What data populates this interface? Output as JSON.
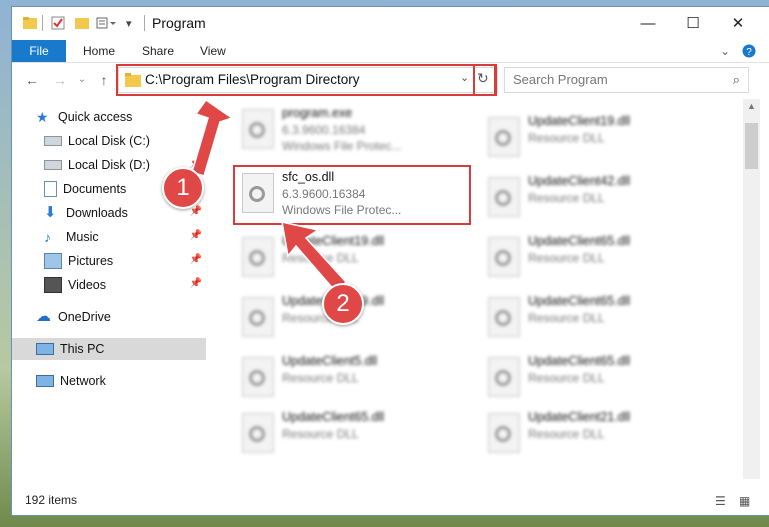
{
  "window": {
    "title": "Program",
    "minimize_glyph": "—",
    "maximize_glyph": "☐",
    "close_glyph": "✕"
  },
  "ribbon": {
    "tabs": [
      "File",
      "Home",
      "Share",
      "View"
    ]
  },
  "address": {
    "path": "C:\\Program Files\\Program Directory"
  },
  "search": {
    "placeholder": "Search Program"
  },
  "nav_pane": {
    "items": [
      {
        "label": "Quick access",
        "icon": "star-icon"
      },
      {
        "label": "Local Disk (C:)",
        "icon": "drive-icon"
      },
      {
        "label": "Local Disk (D:)",
        "icon": "drive-icon"
      },
      {
        "label": "Documents",
        "icon": "documents-icon"
      },
      {
        "label": "Downloads",
        "icon": "download-icon"
      },
      {
        "label": "Music",
        "icon": "music-icon"
      },
      {
        "label": "Pictures",
        "icon": "pictures-icon"
      },
      {
        "label": "Videos",
        "icon": "videos-icon"
      },
      {
        "label": "OneDrive",
        "icon": "cloud-icon"
      },
      {
        "label": "This PC",
        "icon": "computer-icon"
      },
      {
        "label": "Network",
        "icon": "network-icon"
      }
    ]
  },
  "files": [
    {
      "name": "program.exe",
      "line2": "6.3.9600.16384",
      "line3": "Windows File Protec..."
    },
    {
      "name": "sfc_os.dll",
      "line2": "6.3.9600.16384",
      "line3": "Windows File Protec..."
    },
    {
      "name": "UpdateClient19.dll",
      "line2": "Resource DLL",
      "line3": ""
    },
    {
      "name": "UpdateClient19.dll",
      "line2": "Resource DLL",
      "line3": ""
    },
    {
      "name": "UpdateClient5.dll",
      "line2": "Resource DLL",
      "line3": ""
    },
    {
      "name": "UpdateClient65.dll",
      "line2": "Resource DLL",
      "line3": ""
    },
    {
      "name": "UpdateClient19.dll",
      "line2": "Resource DLL",
      "line3": ""
    },
    {
      "name": "UpdateClient42.dll",
      "line2": "Resource DLL",
      "line3": ""
    },
    {
      "name": "UpdateClient65.dll",
      "line2": "Resource DLL",
      "line3": ""
    },
    {
      "name": "UpdateClient65.dll",
      "line2": "Resource DLL",
      "line3": ""
    },
    {
      "name": "UpdateClient65.dll",
      "line2": "Resource DLL",
      "line3": ""
    },
    {
      "name": "UpdateClient21.dll",
      "line2": "Resource DLL",
      "line3": ""
    }
  ],
  "status": {
    "item_count": "192 items"
  },
  "annotations": {
    "step1": "1",
    "step2": "2",
    "highlight_color": "#d93a3a"
  },
  "colors": {
    "accent": "#1979ca",
    "selection": "#d9d9d9"
  }
}
